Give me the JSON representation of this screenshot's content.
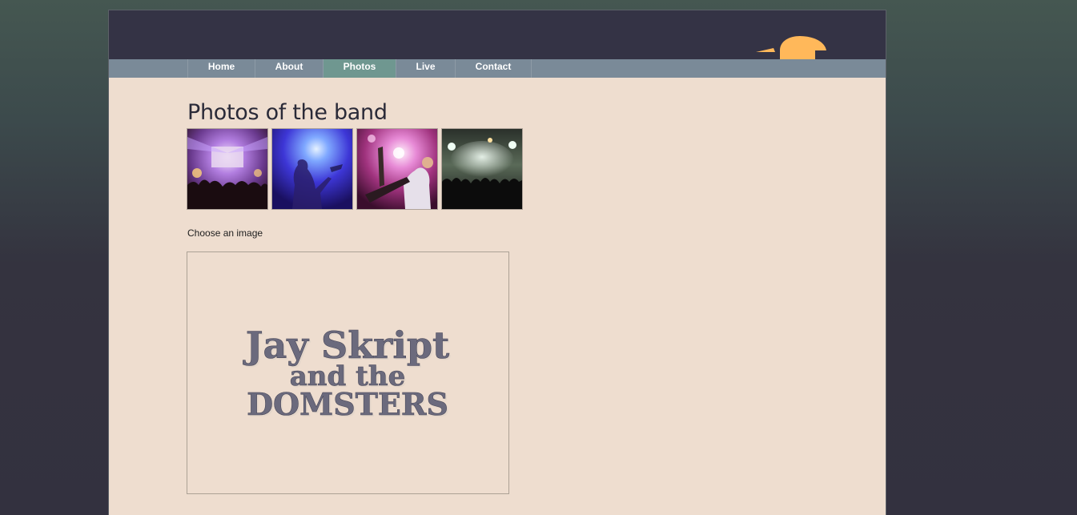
{
  "nav": {
    "items": [
      {
        "label": "Home",
        "active": false
      },
      {
        "label": "About",
        "active": false
      },
      {
        "label": "Photos",
        "active": true
      },
      {
        "label": "Live",
        "active": false
      },
      {
        "label": "Contact",
        "active": false
      }
    ]
  },
  "main": {
    "title": "Photos of the band",
    "caption": "Choose an image",
    "thumbnails": [
      {
        "icon": "concert-stage-photo"
      },
      {
        "icon": "guitarist-blue-photo"
      },
      {
        "icon": "guitarist-pink-photo"
      },
      {
        "icon": "crowd-lights-photo"
      }
    ],
    "viewer": {
      "line1": "Jay Skript",
      "line2": "and the",
      "line3": "DOMSTERS"
    }
  },
  "colors": {
    "header": "#343345",
    "nav": "#7a8a98",
    "nav_active": "#6f9790",
    "content_bg": "#eeddcf",
    "logo_sun": "#ffb85a",
    "band_text": "#6b6a7d"
  }
}
